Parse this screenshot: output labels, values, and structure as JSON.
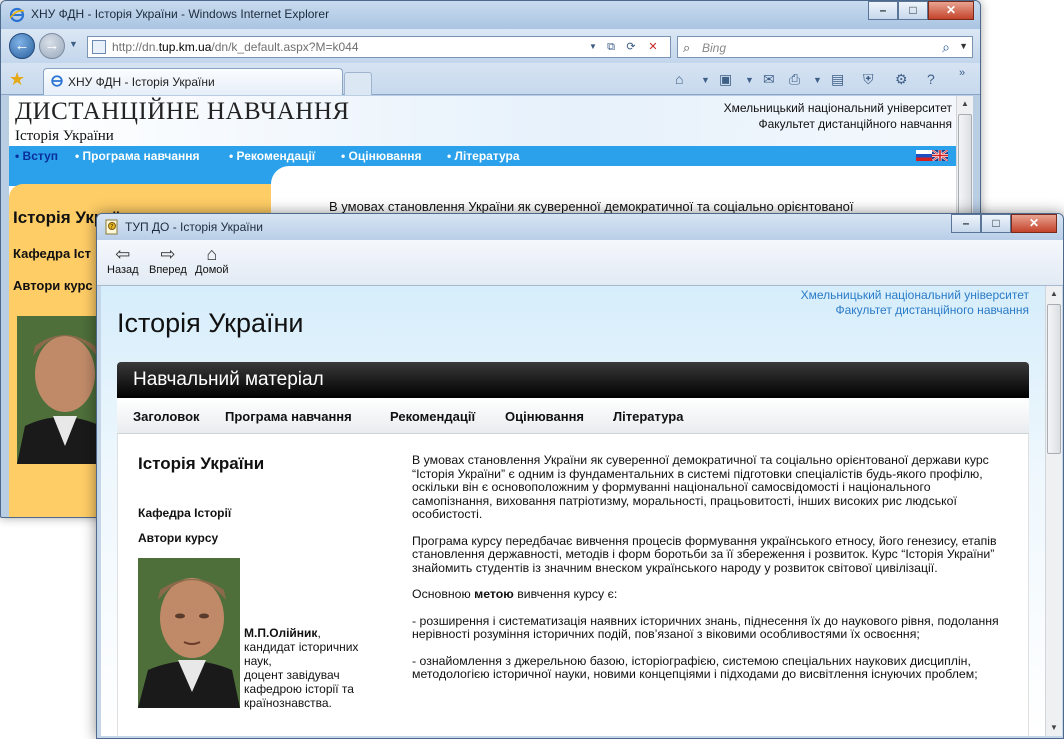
{
  "ie": {
    "title": "ХНУ ФДН - Історія України - Windows Internet Explorer",
    "url_prefix": "http://dn.",
    "url_host": "tup.km.ua",
    "url_suffix": "/dn/k_default.aspx?M=k044",
    "search_placeholder": "Bing",
    "tab_label": "ХНУ ФДН - Історія України"
  },
  "back_page": {
    "title": "ДИСТАНЦІЙНЕ НАВЧАННЯ",
    "subtitle": "Історія України",
    "university": "Хмельницький національний університет",
    "faculty": "Факультет дистанційного навчання",
    "menu": [
      "Вступ",
      "Програма навчання",
      "Рекомендації",
      "Оцінювання",
      "Література"
    ],
    "side_heading": "Історія Україн",
    "side_dept": "Кафедра Іст",
    "side_authors": "Автори курс",
    "intro": "В умовах становлення України як суверенної демократичної та соціально орієнтованої"
  },
  "viewer": {
    "title": "ТУП ДО - Історія України",
    "back": "Назад",
    "forward": "Вперед",
    "home": "Домой",
    "university": "Хмельницький національний університет",
    "faculty": "Факультет дистанційного навчання",
    "course_title": "Історія України",
    "banner": "Навчальний матеріал",
    "menu": [
      "Заголовок",
      "Програма навчання",
      "Рекомендації",
      "Оцінювання",
      "Література"
    ],
    "heading": "Історія України",
    "dept": "Кафедра Історії",
    "authors_label": "Автори курсу",
    "author_name": "М.П.Олійник",
    "author_rest": ",\nкандидат історичних наук,\nдоцент завідувач кафедрою історії та країнознавства.",
    "para1": "В умовах становлення України як суверенної демократичної та соціально орієнтованої держави курс “Історія України” є одним із фундаментальних в системі підготовки спеціалістів будь-якого профілю, оскільки він є основоположним у формуванні національної самосвідомості і національного самопізнання, виховання патріотизму, моральності, працьовитості, інших високих рис людської особистості.",
    "para2": "Програма курсу передбачає вивчення процесів формування українського етносу, його генезису, етапів становлення державності, методів і форм боротьби за її збереження і розвиток. Курс “Історія України” знайомить студентів із значним внеском українського народу у розвиток світової цивілізації.",
    "para3_pre": "Основною ",
    "para3_key": "метою",
    "para3_post": " вивчення курсу є:",
    "para4": "- розширення і систематизація наявних історичних знань, піднесення їх до наукового рівня, подолання нерівності розуміння історичних подій, пов’язаної з віковими особливостями їх освоєння;",
    "para5": "- ознайомлення з джерельною базою, історіографією, системою спеціальних наукових дисциплін, методологією історичної науки, новими концепціями і підходами до висвітлення існуючих проблем;"
  },
  "colors": {
    "menu_blue": "#2aa1ea",
    "side_orange": "#ffcd66",
    "uni_link": "#2a7bc8"
  }
}
